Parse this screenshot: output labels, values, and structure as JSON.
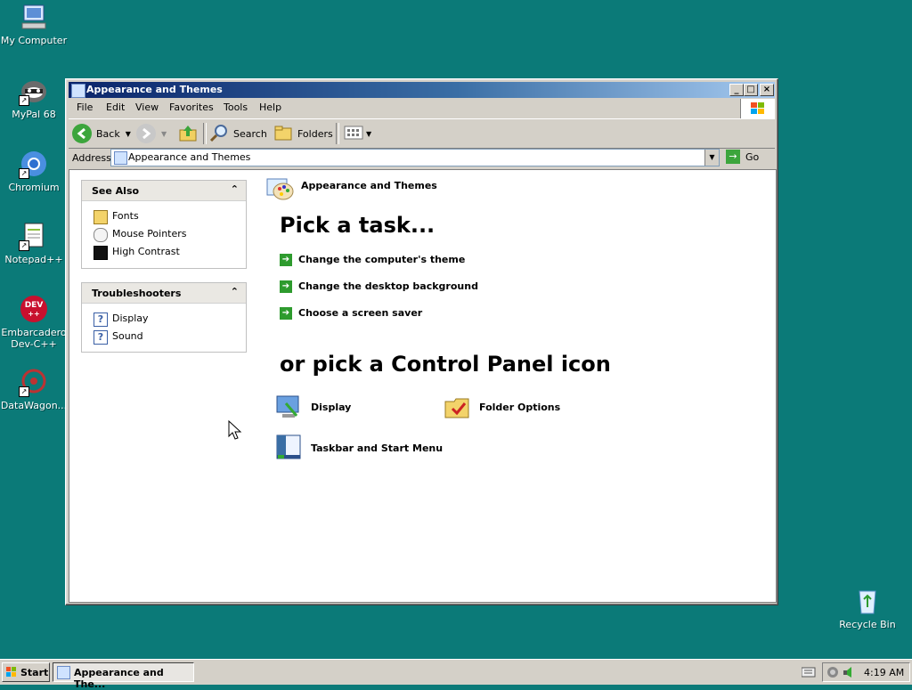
{
  "desktop": {
    "icons": [
      {
        "label": "My Computer"
      },
      {
        "label": "MyPal 68"
      },
      {
        "label": "Chromium"
      },
      {
        "label": "Notepad++"
      },
      {
        "label": "Embarcadero Dev-C++"
      },
      {
        "label": "DataWagon..."
      },
      {
        "label": "Recycle Bin"
      }
    ]
  },
  "window": {
    "title": "Appearance and Themes",
    "menu": [
      "File",
      "Edit",
      "View",
      "Favorites",
      "Tools",
      "Help"
    ],
    "toolbar": {
      "back": "Back",
      "search": "Search",
      "folders": "Folders"
    },
    "address": {
      "label": "Address",
      "value": "Appearance and Themes",
      "go": "Go"
    },
    "header": "Appearance and Themes",
    "see_also": {
      "title": "See Also",
      "items": [
        "Fonts",
        "Mouse Pointers",
        "High Contrast"
      ]
    },
    "troubleshooters": {
      "title": "Troubleshooters",
      "items": [
        "Display",
        "Sound"
      ]
    },
    "pick_task": "Pick a task...",
    "tasks": [
      "Change the computer's theme",
      "Change the desktop background",
      "Choose a screen saver"
    ],
    "pick_icon": "or pick a Control Panel icon",
    "icons": [
      "Display",
      "Folder Options",
      "Taskbar and Start Menu"
    ]
  },
  "taskbar": {
    "start": "Start",
    "task": "Appearance and The...",
    "time": "4:19 AM"
  },
  "colors": {
    "desktop": "#0b7a78",
    "titlebar_start": "#0a246a",
    "titlebar_end": "#a6caf0",
    "task_arrow": "#2e9b2e"
  }
}
